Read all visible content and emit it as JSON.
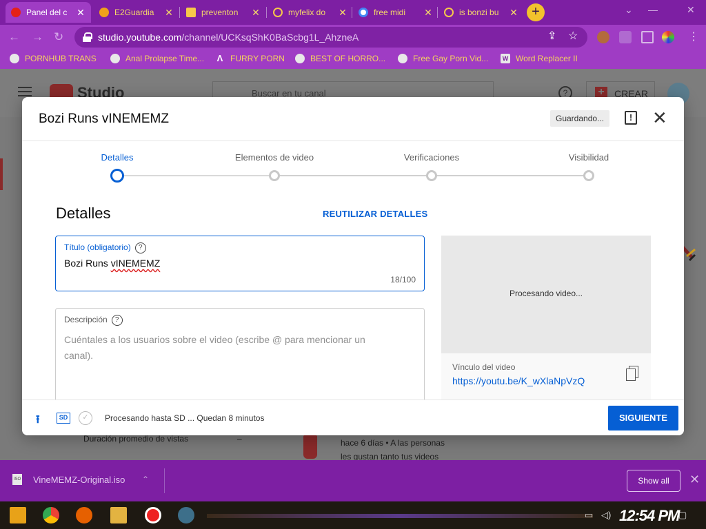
{
  "browser": {
    "tabs": [
      {
        "title": "Panel del c",
        "active": true,
        "favicon_color": "#e62117"
      },
      {
        "title": "E2Guardia",
        "active": false,
        "favicon_color": "#f0a21a"
      },
      {
        "title": "preventon",
        "active": false,
        "favicon_color": "#f6c84a"
      },
      {
        "title": "myfelix do",
        "active": false,
        "favicon_color": "#f6c84a"
      },
      {
        "title": "free midi",
        "active": false,
        "favicon_color": "#4285f4"
      },
      {
        "title": "is bonzi bu",
        "active": false,
        "favicon_color": "#f6c84a"
      }
    ],
    "new_tab_glyph": "+",
    "url_host": "studio.youtube.com",
    "url_path": "/channel/UCKsqShK0BaScbg1L_AhzneA",
    "bookmarks": [
      {
        "label": "PORNHUB TRANS",
        "icon": "globe-icon"
      },
      {
        "label": "Anal Prolapse Time...",
        "icon": "globe-icon"
      },
      {
        "label": "FURRY PORN",
        "icon": "a-icon"
      },
      {
        "label": "BEST OF HORRO...",
        "icon": "globe-icon"
      },
      {
        "label": "Free Gay Porn Vid...",
        "icon": "globe-icon"
      },
      {
        "label": "Word Replacer II",
        "icon": "wr-icon"
      }
    ]
  },
  "studio": {
    "logo_text": "Studio",
    "search_placeholder": "Buscar en tu canal",
    "create_label": "CREAR",
    "help_glyph": "?",
    "under_metric": "Duración promedio de vistas",
    "under_metric_value": "–",
    "under_comment_line1": "hace 6 días • A las personas",
    "under_comment_line2": "les gustan tanto tus videos"
  },
  "dialog": {
    "title": "Bozi Runs vINEMEMZ",
    "saving_label": "Guardando...",
    "feedback_glyph": "!",
    "close_glyph": "✕",
    "steps": [
      {
        "label": "Detalles",
        "active": true
      },
      {
        "label": "Elementos de video",
        "active": false
      },
      {
        "label": "Verificaciones",
        "active": false
      },
      {
        "label": "Visibilidad",
        "active": false
      }
    ],
    "section_title": "Detalles",
    "reuse_label": "REUTILIZAR DETALLES",
    "title_field": {
      "label": "Título (obligatorio)",
      "value_prefix": "Bozi Runs ",
      "value_misspelled": "vINEMEMZ",
      "counter": "18/100"
    },
    "description_field": {
      "label": "Descripción",
      "placeholder": "Cuéntales a los usuarios sobre el video (escribe @ para mencionar un canal)."
    },
    "help_glyph": "?",
    "preview": {
      "processing_label": "Procesando video...",
      "link_label": "Vínculo del video",
      "link_url": "https://youtu.be/K_wXlaNpVzQ"
    },
    "footer": {
      "sd_label": "SD",
      "status": "Procesando hasta SD ... Quedan 8 minutos",
      "next_label": "SIGUIENTE"
    }
  },
  "download_bar": {
    "file_name": "VineMEMZ-Original.iso",
    "file_badge": "ISO",
    "show_all_label": "Show all"
  },
  "taskbar": {
    "clock": "12:54 PM"
  },
  "colors": {
    "browser_frame": "#9f3cc4",
    "tab_strip": "#7d1fa3",
    "bookmark_text": "#f4d35e",
    "accent_blue": "#065fd4"
  }
}
